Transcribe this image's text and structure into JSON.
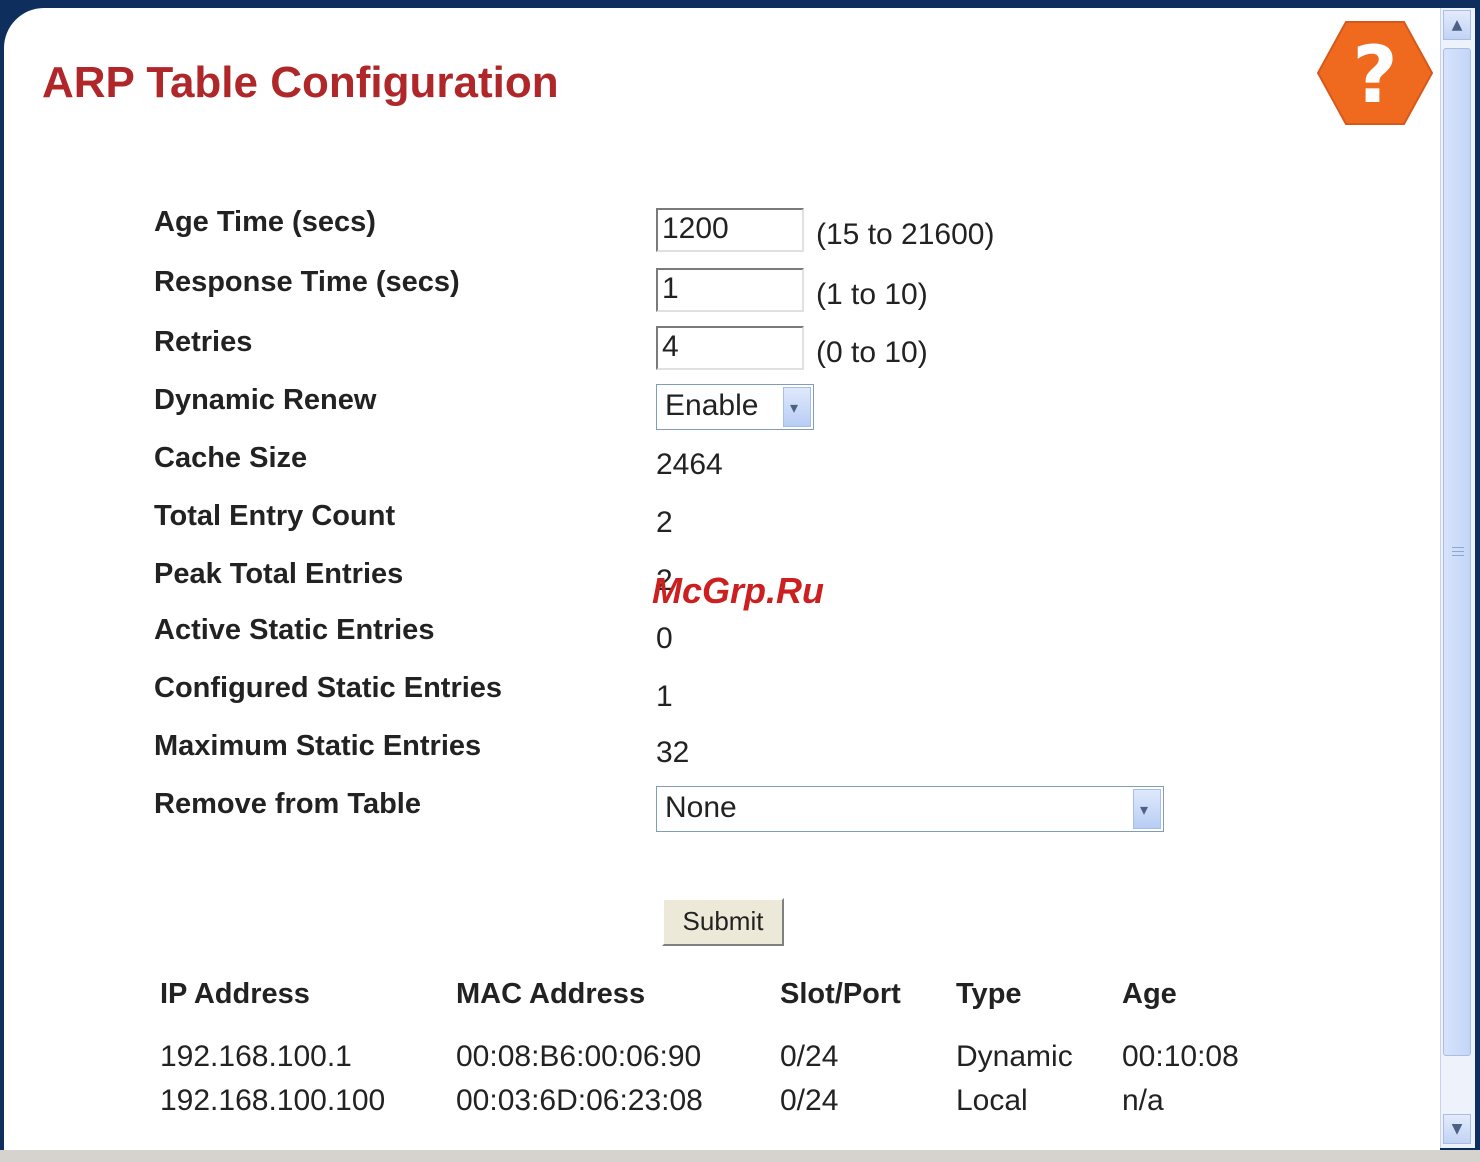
{
  "page": {
    "title": "ARP Table Configuration",
    "help_symbol": "?",
    "accent_color": "#b0272a",
    "help_color": "#ef6a1e"
  },
  "form": {
    "age_time": {
      "label": "Age Time (secs)",
      "value": "1200",
      "range": "(15 to 21600)"
    },
    "response_time": {
      "label": "Response Time (secs)",
      "value": "1",
      "range": "(1 to 10)"
    },
    "retries": {
      "label": "Retries",
      "value": "4",
      "range": "(0 to 10)"
    },
    "dynamic_renew": {
      "label": "Dynamic Renew",
      "selected": "Enable"
    },
    "cache_size": {
      "label": "Cache Size",
      "value": "2464"
    },
    "total_entry_count": {
      "label": "Total Entry Count",
      "value": "2"
    },
    "peak_total_entries": {
      "label": "Peak Total Entries",
      "value": "2"
    },
    "active_static_entries": {
      "label": "Active Static Entries",
      "value": "0"
    },
    "configured_static_entries": {
      "label": "Configured Static Entries",
      "value": "1"
    },
    "maximum_static_entries": {
      "label": "Maximum Static Entries",
      "value": "32"
    },
    "remove_from_table": {
      "label": "Remove from Table",
      "selected": "None"
    },
    "submit_label": "Submit"
  },
  "arp_table": {
    "headers": [
      "IP Address",
      "MAC Address",
      "Slot/Port",
      "Type",
      "Age"
    ],
    "rows": [
      [
        "192.168.100.1",
        "00:08:B6:00:06:90",
        "0/24",
        "Dynamic",
        "00:10:08"
      ],
      [
        "192.168.100.100",
        "00:03:6D:06:23:08",
        "0/24",
        "Local",
        "n/a"
      ]
    ]
  },
  "watermark": "McGrp.Ru"
}
